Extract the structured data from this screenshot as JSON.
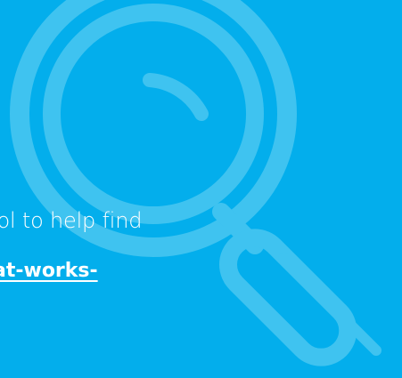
{
  "background_color": "#03aeec",
  "accent_color": "#3fc3f0",
  "background_icon": "magnifying-glass-icon",
  "text": {
    "line1": "ool to help find",
    "line2": ":",
    "link": "at-works-"
  }
}
